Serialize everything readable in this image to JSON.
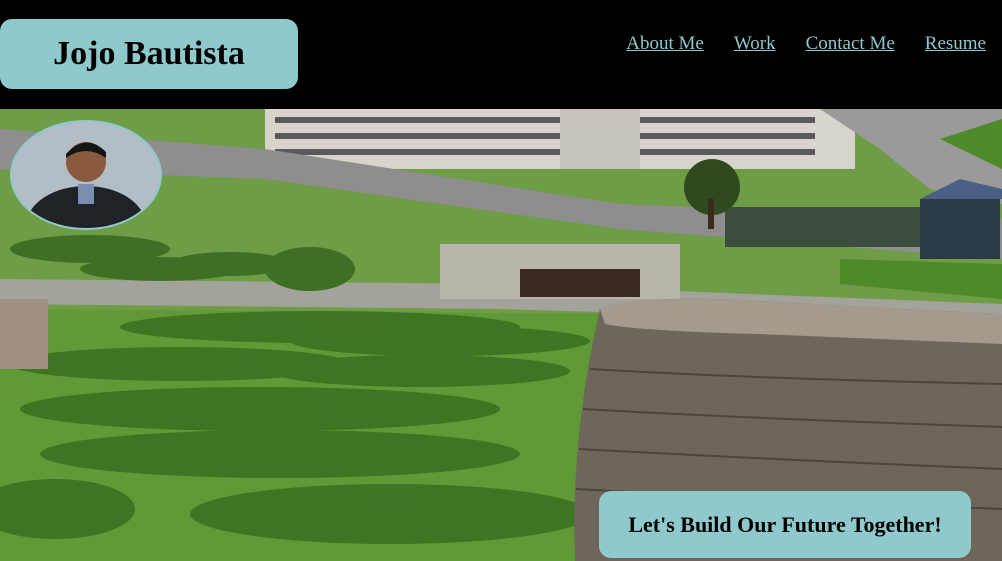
{
  "header": {
    "brand_name": "Jojo Bautista",
    "nav": [
      {
        "label": "About Me"
      },
      {
        "label": "Work"
      },
      {
        "label": "Contact Me"
      },
      {
        "label": "Resume"
      }
    ]
  },
  "hero": {
    "tagline": "Let's Build Our Future Together!"
  },
  "colors": {
    "accent": "#8fc9cc",
    "background": "#000000"
  }
}
